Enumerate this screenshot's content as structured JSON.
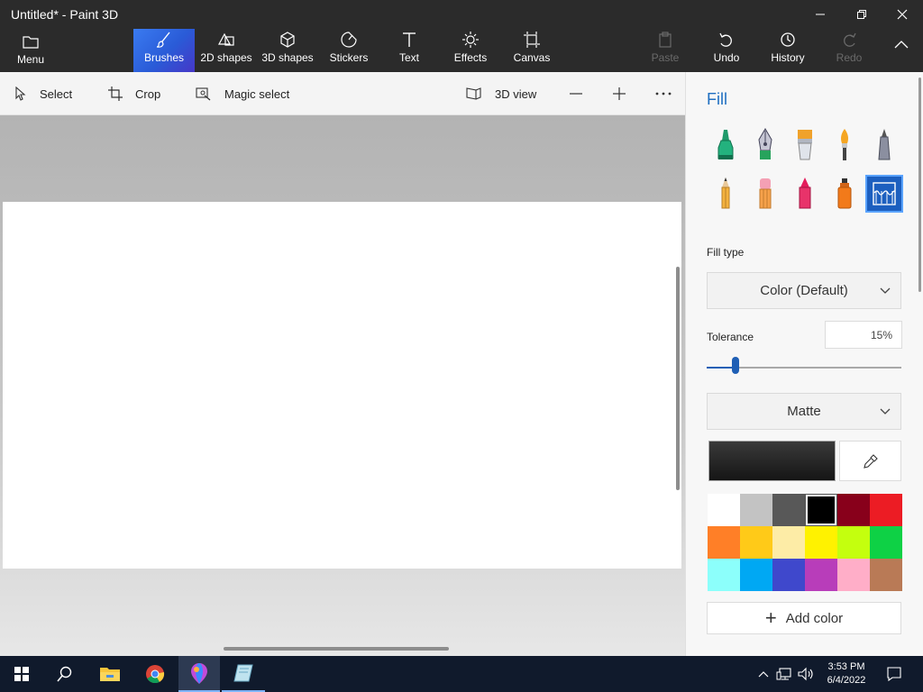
{
  "window": {
    "title": "Untitled* - Paint 3D",
    "controls": [
      "minimize-icon",
      "restore-icon",
      "close-icon"
    ]
  },
  "ribbon": {
    "items": [
      {
        "label": "Menu",
        "icon": "folder-icon"
      },
      {
        "label": "Brushes",
        "icon": "brush-icon",
        "selected": true
      },
      {
        "label": "2D shapes",
        "icon": "2d-shapes-icon"
      },
      {
        "label": "3D shapes",
        "icon": "cube-icon"
      },
      {
        "label": "Stickers",
        "icon": "sticker-icon"
      },
      {
        "label": "Text",
        "icon": "text-icon"
      },
      {
        "label": "Effects",
        "icon": "sun-icon"
      },
      {
        "label": "Canvas",
        "icon": "canvas-icon"
      },
      {
        "label": "Paste",
        "icon": "paste-icon",
        "disabled": true
      },
      {
        "label": "Undo",
        "icon": "undo-icon"
      },
      {
        "label": "History",
        "icon": "history-icon"
      },
      {
        "label": "Redo",
        "icon": "redo-icon",
        "disabled": true
      }
    ]
  },
  "toolbar": {
    "select": "Select",
    "crop": "Crop",
    "magic_select": "Magic select",
    "view_3d": "3D view"
  },
  "panel": {
    "title": "Fill",
    "brushes": [
      "marker-icon",
      "calligraphy-pen-icon",
      "oil-brush-icon",
      "watercolor-icon",
      "pixel-pen-icon",
      "pencil-icon",
      "eraser-icon",
      "crayon-icon",
      "spray-can-icon",
      "fill-bucket-icon"
    ],
    "selected_brush": "fill-bucket-icon",
    "fill_type_label": "Fill type",
    "fill_type_value": "Color (Default)",
    "tolerance_label": "Tolerance",
    "tolerance_value": "15%",
    "tolerance_level": 0.15,
    "finish_value": "Matte",
    "current_color": "#000000",
    "add_color_label": "Add color",
    "palette": [
      "#ffffff",
      "#c3c3c3",
      "#585858",
      "#000000",
      "#88001b",
      "#ec1c24",
      "#ff7f27",
      "#ffca18",
      "#fdeca6",
      "#fff200",
      "#c4ff0e",
      "#0ed145",
      "#8cfffb",
      "#00a8f3",
      "#3f48cc",
      "#b83dba",
      "#ffaec8",
      "#b97a56"
    ],
    "selected_palette_index": 3,
    "accent_color": "#1f6fc1"
  },
  "taskbar": {
    "apps": [
      "windows-start-icon",
      "search-icon",
      "file-explorer-icon",
      "chrome-icon",
      "paint-3d-icon",
      "snipping-tool-icon"
    ],
    "time": "3:53 PM",
    "date": "6/4/2022",
    "tray": [
      "chevron-up-icon",
      "network-icon",
      "volume-icon",
      "notification-icon"
    ]
  }
}
